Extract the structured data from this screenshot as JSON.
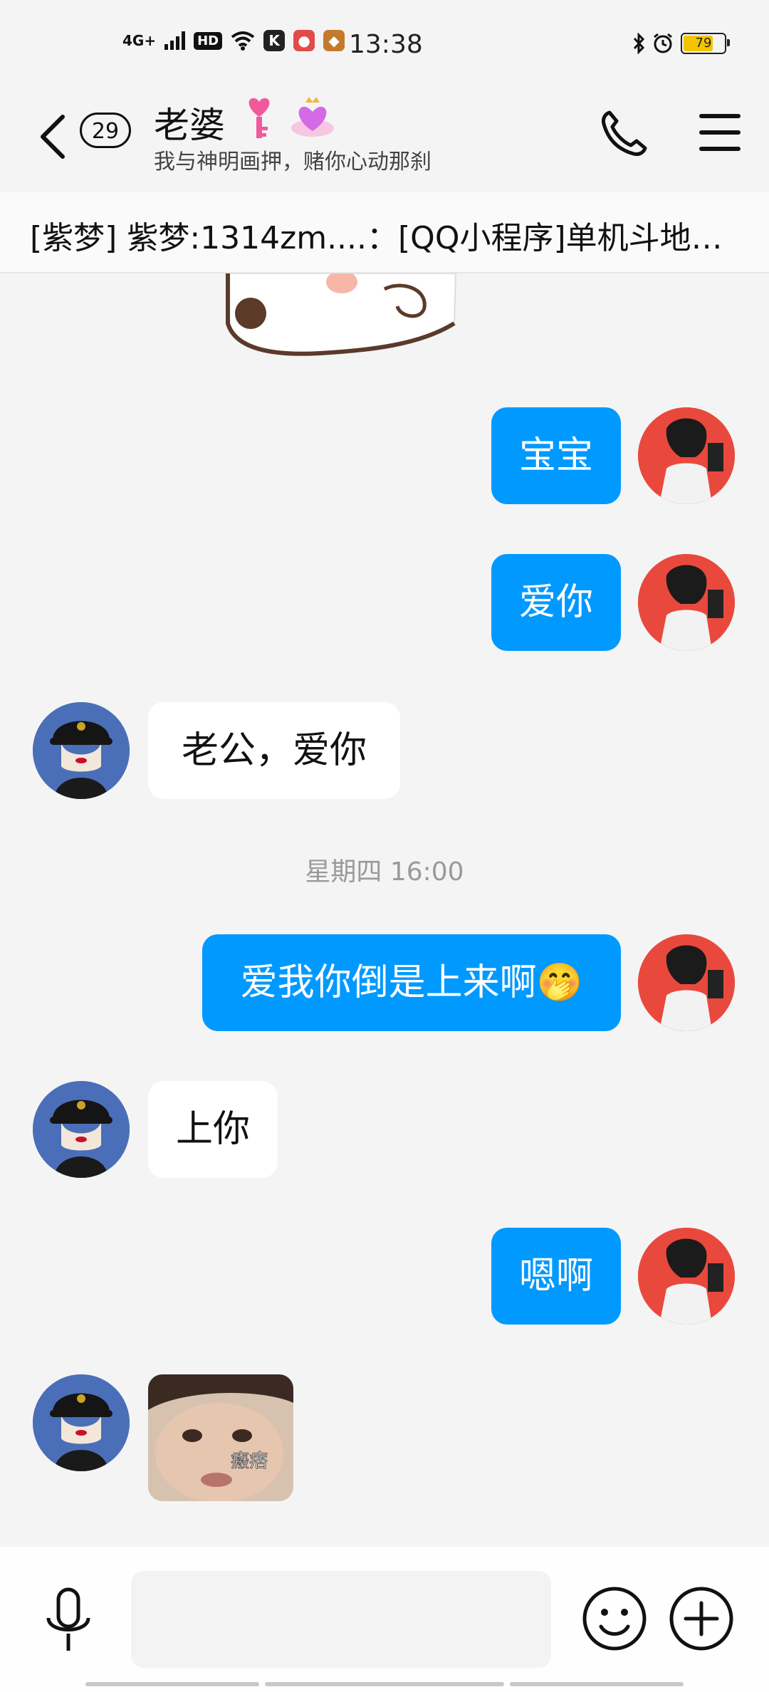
{
  "status_bar": {
    "network": "4G+",
    "hd": "HD",
    "app_k": "K",
    "time": "13:38",
    "battery": 79
  },
  "header": {
    "unread_count": "29",
    "name": "老婆",
    "signature": "我与神明画押，赌你心动那刹"
  },
  "pinned_notice": "[紫梦] 紫梦:1314zm....：[QQ小程序]单机斗地…",
  "messages": [
    {
      "side": "right",
      "text": "宝宝"
    },
    {
      "side": "right",
      "text": "爱你"
    },
    {
      "side": "left",
      "text": "老公，爱你"
    },
    {
      "side": "right",
      "text": "爱我你倒是上来啊🤭"
    },
    {
      "side": "left",
      "text": "上你"
    },
    {
      "side": "right",
      "text": "嗯啊"
    }
  ],
  "timestamp": "星期四 16:00",
  "image_message_caption": "瘢痞",
  "input": {
    "placeholder": ""
  },
  "colors": {
    "my_bubble": "#0099ff",
    "her_bubble": "#ffffff",
    "background": "#f4f4f4"
  }
}
